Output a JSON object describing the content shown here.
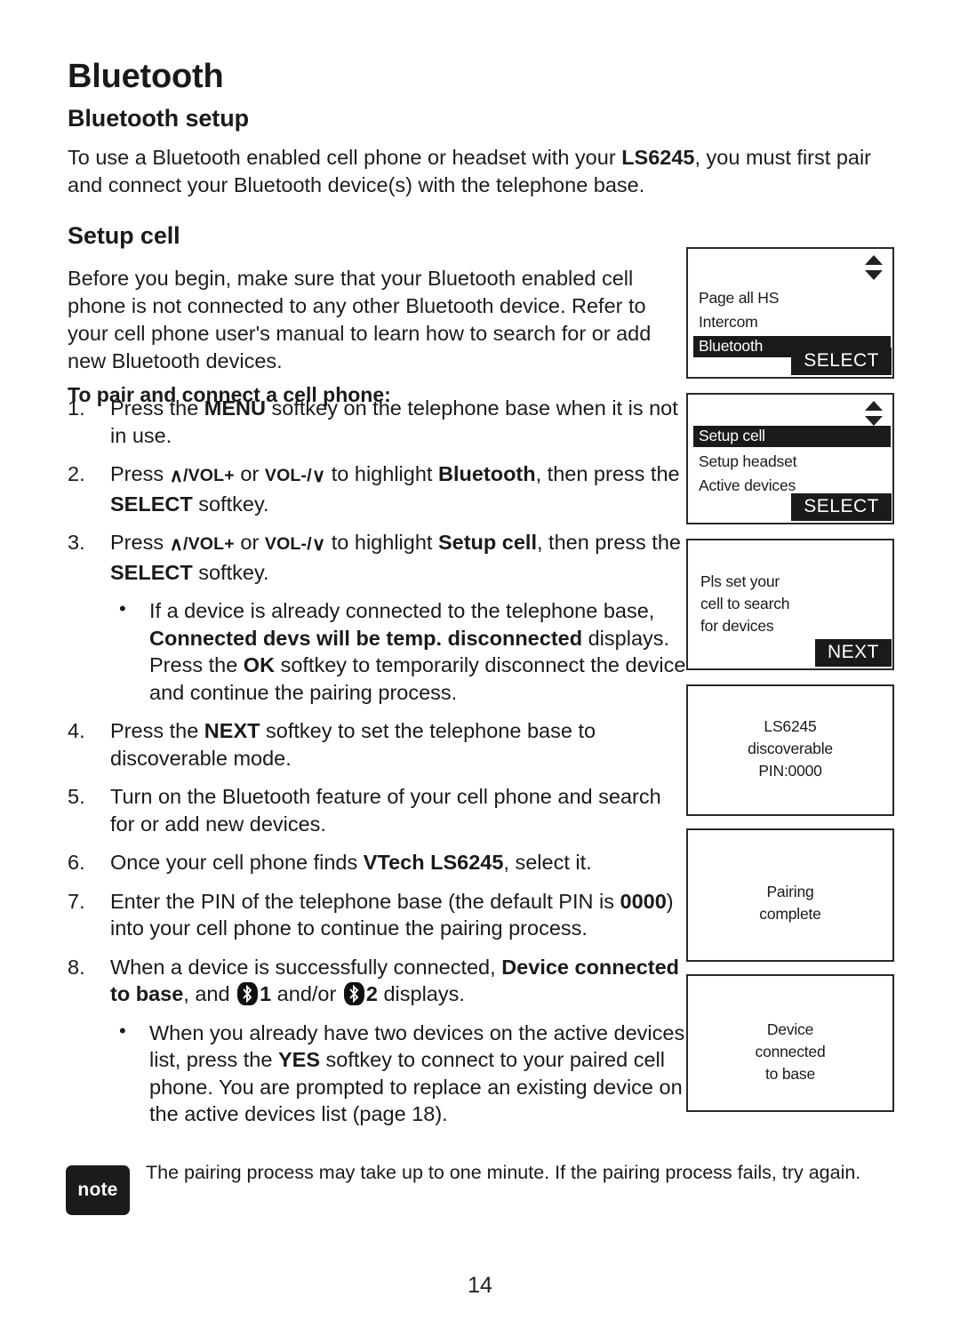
{
  "page": {
    "title": "Bluetooth",
    "number": "14"
  },
  "sections": {
    "bluetooth_setup": {
      "heading": "Bluetooth setup",
      "intro_a": "To use a Bluetooth enabled cell phone or headset with your ",
      "intro_model": "LS6245",
      "intro_b": ", you must first pair and connect your Bluetooth device(s) with the telephone base."
    },
    "setup_cell": {
      "heading": "Setup cell",
      "before": "Before you begin, make sure that your Bluetooth enabled cell phone is not connected to any other Bluetooth device. Refer to your cell phone user's manual to learn how to search for or add new Bluetooth devices.",
      "subheading": "To pair and connect a cell phone:"
    }
  },
  "steps": {
    "s1": {
      "num": "1.",
      "a": "Press the ",
      "key": "MENU",
      "b": " softkey on the telephone base when it is not in use."
    },
    "s2": {
      "num": "2.",
      "a": "Press ",
      "volup_chevron": "∧",
      "volup": "/VOL+",
      "mid": " or ",
      "voldn": "VOL-/",
      "voldn_chevron": "∨",
      "b": " to highlight ",
      "target": "Bluetooth",
      "c": ", then press the ",
      "key2": "SELECT",
      "d": " softkey."
    },
    "s3": {
      "num": "3.",
      "a": "Press ",
      "volup_chevron": "∧",
      "volup": "/VOL+",
      "mid": " or ",
      "voldn": "VOL-/",
      "voldn_chevron": "∨",
      "b": " to highlight ",
      "target": "Setup cell",
      "c": ", then press the ",
      "key2": "SELECT",
      "d": " softkey."
    },
    "s3_bullet": {
      "bullet": "•",
      "a": "If a device is already connected to the telephone base, ",
      "msg": "Connected devs will be temp. disconnected",
      "b": " displays. Press the ",
      "key": "OK",
      "c": " softkey to temporarily disconnect the device and continue the pairing process."
    },
    "s4": {
      "num": "4.",
      "a": "Press the ",
      "key": "NEXT",
      "b": " softkey to set the telephone base to discoverable mode."
    },
    "s5": {
      "num": "5.",
      "a": "Turn on the Bluetooth feature of your cell phone and search for or add new devices."
    },
    "s6": {
      "num": "6.",
      "a": "Once your cell phone finds ",
      "key": "VTech LS6245",
      "b": ", select it."
    },
    "s7": {
      "num": "7.",
      "a": "Enter the PIN of the telephone base (the default PIN is ",
      "pin": "0000",
      "b": ") into your cell phone to continue the pairing process."
    },
    "s8": {
      "num": "8.",
      "a": "When a device is successfully connected, ",
      "msg": "Device connected to base",
      "b": ", and ",
      "count1": "1",
      "mid": " and/or ",
      "count2": "2",
      "c": " displays."
    },
    "s8_bullet": {
      "bullet": "•",
      "a": "When you already have two devices on the active devices list, press the ",
      "key": "YES",
      "b": " softkey to connect to your paired cell phone. You are prompted to replace an existing device on the active devices list (page 18)."
    }
  },
  "lcd_screens": [
    {
      "id": "menu-list",
      "scroll_arrow": true,
      "rows": [
        {
          "text": "Page all HS",
          "highlighted": false
        },
        {
          "text": "Intercom",
          "highlighted": false
        },
        {
          "text": "Bluetooth",
          "highlighted": true
        }
      ],
      "softkey": "SELECT"
    },
    {
      "id": "bluetooth-submenu",
      "scroll_arrow": true,
      "rows": [
        {
          "text": "Setup cell",
          "highlighted": true
        },
        {
          "text": "Setup headset",
          "highlighted": false
        },
        {
          "text": "Active devices",
          "highlighted": false
        }
      ],
      "softkey": "SELECT"
    },
    {
      "id": "set-cell-to-search",
      "scroll_arrow": false,
      "lines": [
        "Pls set your",
        "cell to search",
        "for devices"
      ],
      "align": "left",
      "softkey": "NEXT"
    },
    {
      "id": "discoverable",
      "scroll_arrow": false,
      "lines": [
        "LS6245",
        "discoverable",
        "PIN:0000"
      ],
      "align": "center",
      "softkey": ""
    },
    {
      "id": "pairing-complete",
      "scroll_arrow": false,
      "lines": [
        "Pairing",
        "complete"
      ],
      "align": "center",
      "softkey": ""
    },
    {
      "id": "device-connected",
      "scroll_arrow": false,
      "lines": [
        "Device",
        "connected",
        "to base"
      ],
      "align": "center",
      "softkey": ""
    }
  ],
  "note": {
    "badge": "note",
    "text": "The pairing process may take up to one minute. If the pairing process fails, try again."
  },
  "colors": {
    "ink": "#1a1a1a",
    "highlight_bg": "#1a1a1a",
    "highlight_fg": "#ffffff",
    "page_bg": "#ffffff"
  }
}
